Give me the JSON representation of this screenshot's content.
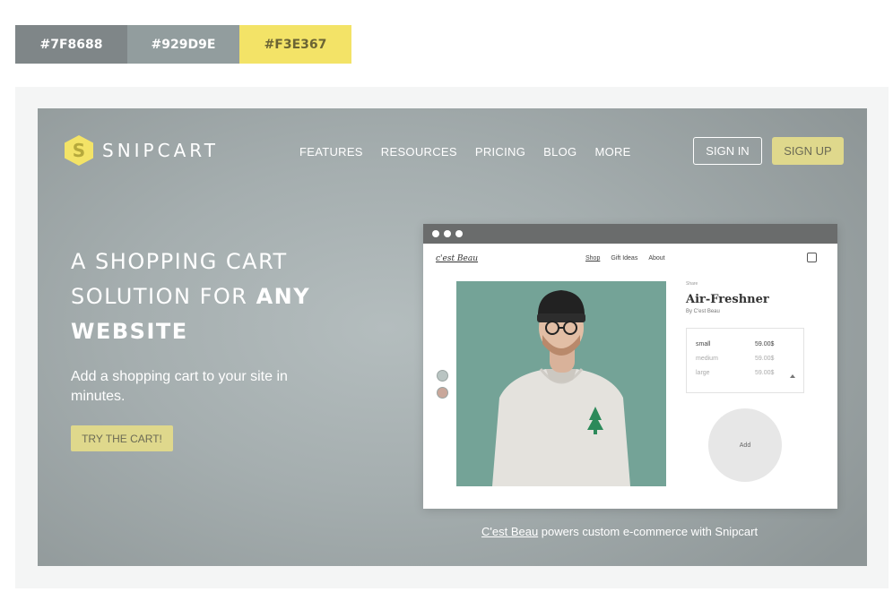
{
  "palette": [
    {
      "label": "#7F8688",
      "color": "#7F8688",
      "text_color": "#ffffff"
    },
    {
      "label": "#929D9E",
      "color": "#929D9E",
      "text_color": "#ffffff"
    },
    {
      "label": "#F3E367",
      "color": "#F3E367",
      "text_color": "#6b6434"
    }
  ],
  "header": {
    "logo_text": "SNIPCART",
    "logo_mark": "S",
    "nav": [
      "FEATURES",
      "RESOURCES",
      "PRICING",
      "BLOG",
      "MORE"
    ],
    "sign_in": "SIGN IN",
    "sign_up": "SIGN UP"
  },
  "hero": {
    "headline_line1": "A SHOPPING CART",
    "headline_line2_pre": "SOLUTION FOR ",
    "headline_line2_bold": "ANY",
    "headline_line3_bold": "WEBSITE",
    "subheadline": "Add a shopping cart to your site in minutes.",
    "cta": "TRY THE CART!"
  },
  "demo_site": {
    "logo": "c'est Beau",
    "nav": [
      "Shop",
      "Gift Ideas",
      "About"
    ],
    "share": "Share",
    "product_title": "Air-Freshner",
    "product_by": "By C'est Beau",
    "variants": [
      {
        "name": "small",
        "price": "59.00$"
      },
      {
        "name": "medium",
        "price": "59.00$"
      },
      {
        "name": "large",
        "price": "59.00$"
      }
    ],
    "add_label": "Add"
  },
  "caption": {
    "link": "C'est Beau",
    "text": " powers custom e-commerce with Snipcart"
  }
}
